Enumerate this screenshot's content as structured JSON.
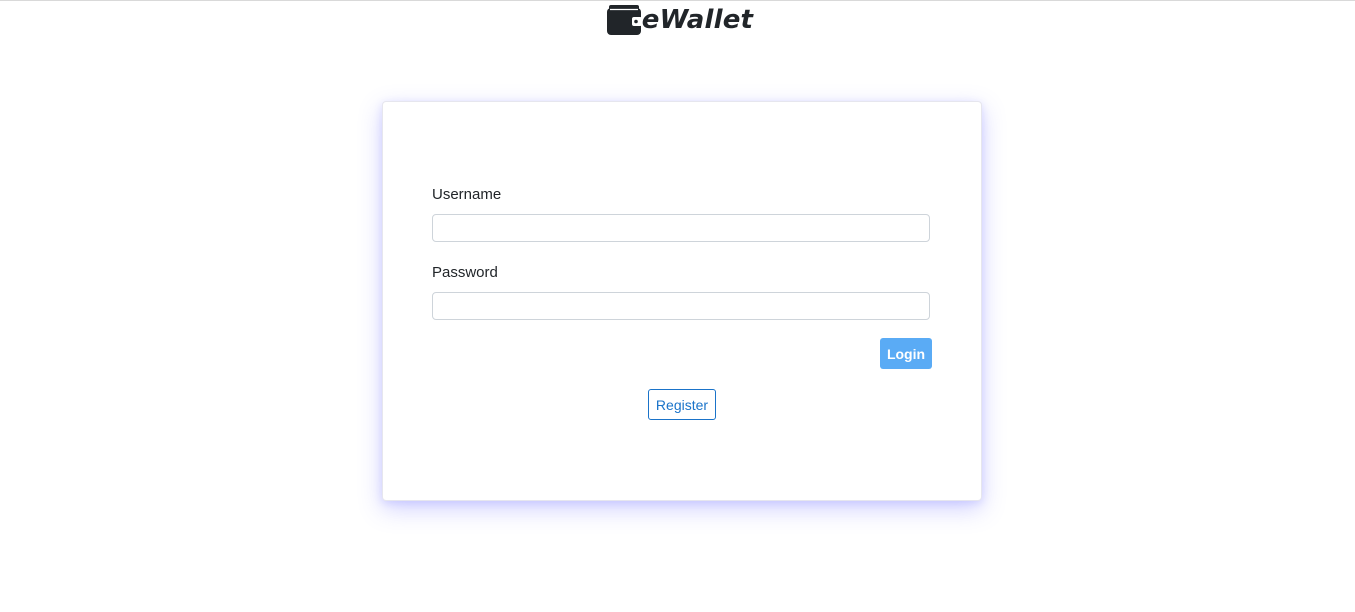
{
  "brand": {
    "icon": "wallet-icon",
    "name": "eWallet"
  },
  "login_form": {
    "username_label": "Username",
    "username_value": "",
    "password_label": "Password",
    "password_value": "",
    "login_label": "Login",
    "register_label": "Register"
  },
  "colors": {
    "login_button": "#5aabf5",
    "register_outline": "#1a73c9",
    "card_glow": "#5a5aff",
    "brand_text": "#212529"
  }
}
